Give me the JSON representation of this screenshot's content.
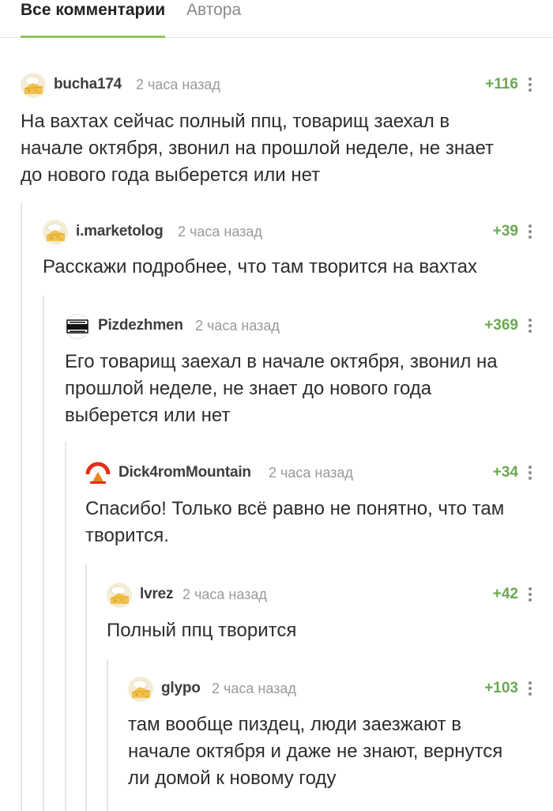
{
  "tabs": {
    "all": "Все комментарии",
    "author": "Автора"
  },
  "accent_color": "#8ac858",
  "rating_color": "#6aa84f",
  "comments": [
    {
      "username": "bucha174",
      "time": "2 часа назад",
      "rating": "+116",
      "avatar": "default-cheese-avatar",
      "text": "На вахтах сейчас полный ппц, товарищ заехал в начале октября, звонил на прошлой неделе, не знает до нового года выберется или нет"
    },
    {
      "username": "i.marketolog",
      "time": "2 часа назад",
      "rating": "+39",
      "avatar": "default-cheese-avatar",
      "text": "Расскажи подробнее, что там творится на вахтах"
    },
    {
      "username": "Pizdezhmen",
      "time": "2 часа назад",
      "rating": "+369",
      "avatar": "parental-advisory-avatar",
      "text": "Его товарищ заехал в начале октября, звонил на прошлой неделе, не знает до нового года выберется или нет"
    },
    {
      "username": "Dick4romMountain",
      "time": "2 часа назад",
      "rating": "+34",
      "avatar": "red-mountain-avatar",
      "text": "Спасибо! Только всё равно не понятно, что там творится."
    },
    {
      "username": "lvrez",
      "time": "2 часа назад",
      "rating": "+42",
      "avatar": "default-cheese-avatar",
      "text": "Полный ппц творится"
    },
    {
      "username": "glypo",
      "time": "2 часа назад",
      "rating": "+103",
      "avatar": "default-cheese-avatar",
      "text": "там вообще пиздец, люди заезжают в начале октября и даже не знают, вернутся ли домой к новому году"
    }
  ]
}
